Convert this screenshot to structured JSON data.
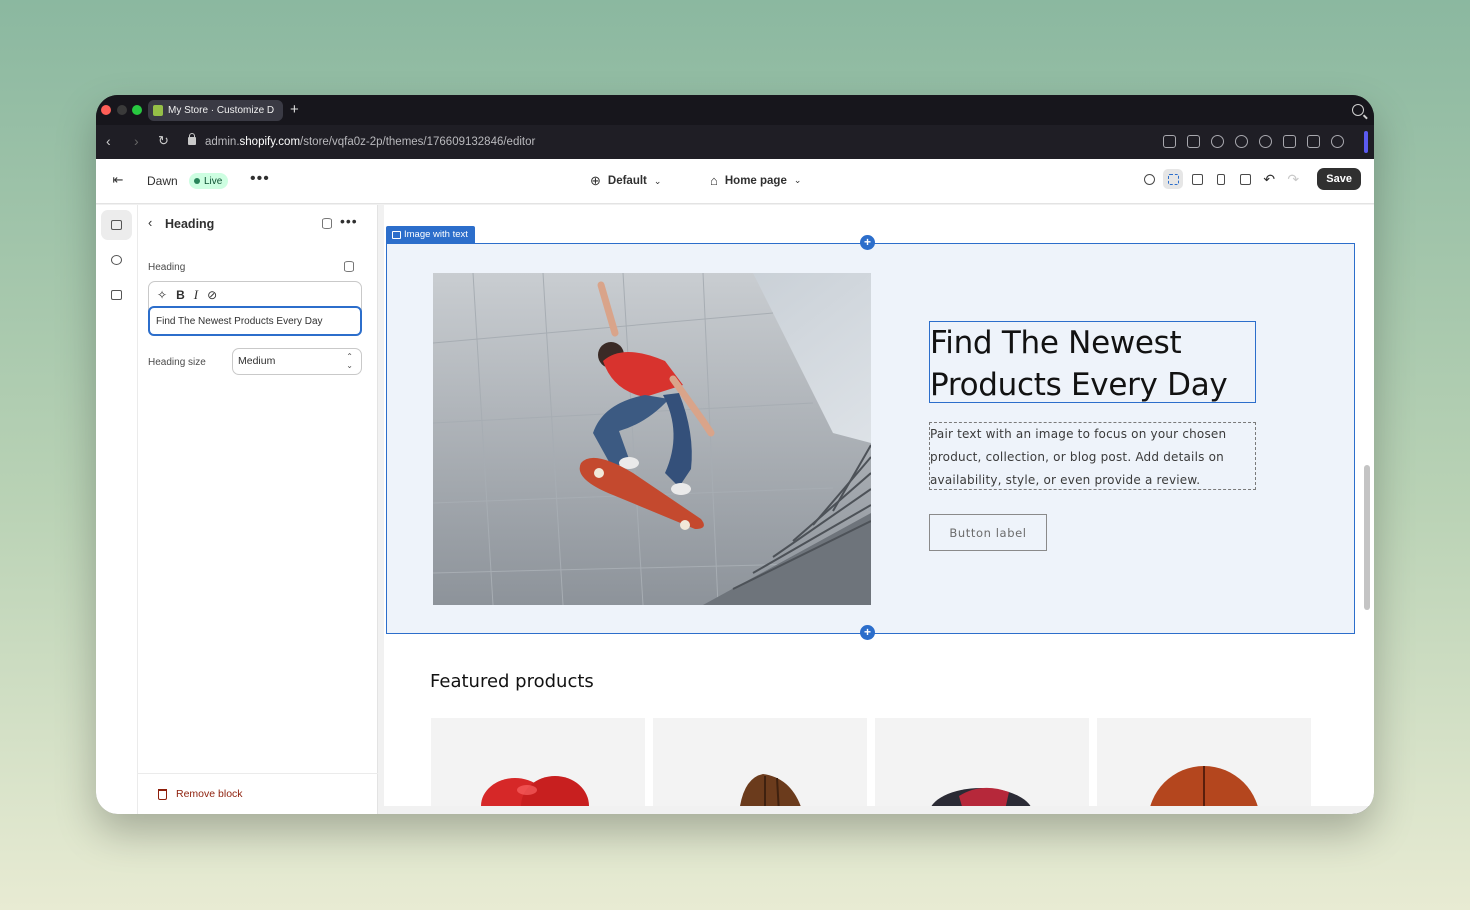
{
  "browser": {
    "tab_title": "My Store · Customize D",
    "new_tab": "+",
    "url_prefix": "admin.",
    "url_domain": "shopify.com",
    "url_path": "/store/vqfa0z-2p/themes/176609132846/editor"
  },
  "editor": {
    "theme_name": "Dawn",
    "status_badge": "Live",
    "more": "•••",
    "context_selector": "Default",
    "page_selector": "Home page",
    "save_label": "Save"
  },
  "panel": {
    "title": "Heading",
    "field_label": "Heading",
    "heading_value": "Find The Newest Products Every Day",
    "size_label": "Heading size",
    "size_value": "Medium",
    "remove_label": "Remove block"
  },
  "preview": {
    "section_tag": "Image with text",
    "heading": "Find The Newest Products Every Day",
    "body": "Pair text with an image to focus on your chosen product, collection, or blog post. Add details on availability, style, or even provide a review.",
    "button_label": "Button label",
    "featured_title": "Featured products",
    "products": [
      {
        "icon": "boxing-gloves-icon",
        "color": "#d62828"
      },
      {
        "icon": "baseball-glove-icon",
        "color": "#6b3b1c"
      },
      {
        "icon": "helmet-icon",
        "color": "#2b2b35"
      },
      {
        "icon": "basketball-icon",
        "color": "#b4461e"
      }
    ]
  },
  "colors": {
    "accent": "#2c6ecb",
    "live_bg": "#cdfee1",
    "danger": "#8e1f0b"
  }
}
